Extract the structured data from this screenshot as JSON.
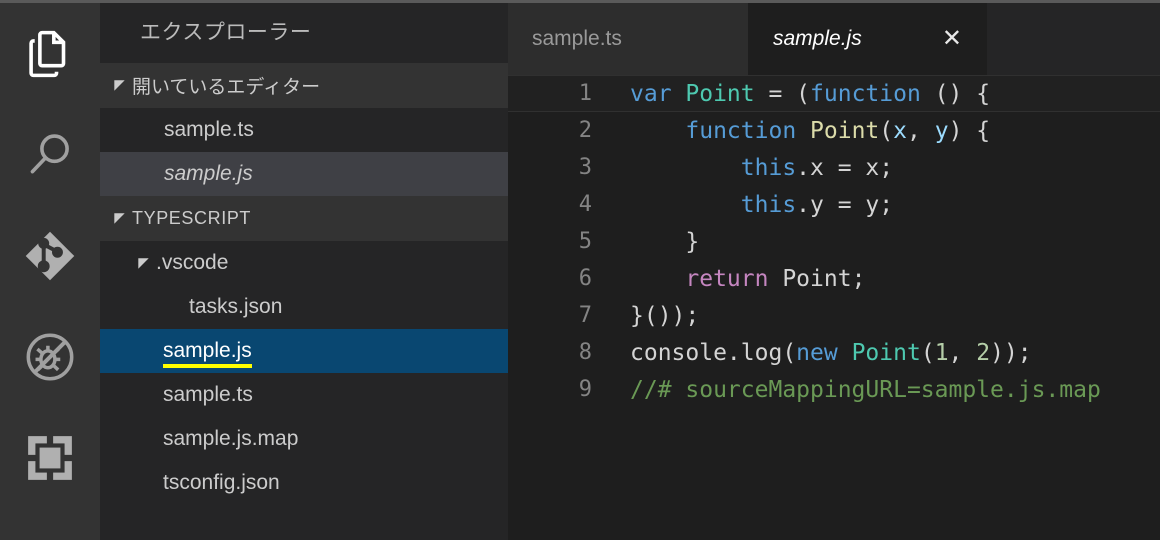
{
  "theme": {
    "activity_bar_bg": "#333333",
    "sidebar_bg": "#252526",
    "editor_bg": "#1e1e1e",
    "tab_active_bg": "#1e1e1e",
    "tab_inactive_bg": "#2d2d2d",
    "selection_blue": "#094771",
    "hover_grey": "#3f4045",
    "annotation_yellow": "#ffff00",
    "line_number_fg": "#848484"
  },
  "activity_bar": {
    "items": [
      {
        "name": "explorer",
        "icon": "files-icon",
        "active": true
      },
      {
        "name": "search",
        "icon": "search-icon",
        "active": false
      },
      {
        "name": "source-control",
        "icon": "git-branch-icon",
        "active": false
      },
      {
        "name": "debug",
        "icon": "debug-icon",
        "active": false
      },
      {
        "name": "extensions",
        "icon": "extensions-icon",
        "active": false
      }
    ]
  },
  "sidebar": {
    "title": "エクスプローラー",
    "open_editors": {
      "header": "開いているエディター",
      "items": [
        {
          "label": "sample.ts",
          "italic": false,
          "state": "normal"
        },
        {
          "label": "sample.js",
          "italic": true,
          "state": "hovered"
        }
      ]
    },
    "project": {
      "header": "TYPESCRIPT",
      "items": [
        {
          "label": ".vscode",
          "type": "folder",
          "depth": 1,
          "expanded": true,
          "state": "normal"
        },
        {
          "label": "tasks.json",
          "type": "file",
          "depth": 2,
          "state": "normal"
        },
        {
          "label": "sample.js",
          "type": "file",
          "depth": 1,
          "state": "selected",
          "annotated": true
        },
        {
          "label": "sample.ts",
          "type": "file",
          "depth": 1,
          "state": "normal"
        },
        {
          "label": "sample.js.map",
          "type": "file",
          "depth": 1,
          "state": "normal"
        },
        {
          "label": "tsconfig.json",
          "type": "file",
          "depth": 1,
          "state": "normal"
        }
      ]
    }
  },
  "editor": {
    "tabs": [
      {
        "label": "sample.ts",
        "active": false,
        "italic": false,
        "closable": false
      },
      {
        "label": "sample.js",
        "active": true,
        "italic": true,
        "closable": true,
        "close_glyph": "✕"
      }
    ],
    "language": "javascript",
    "active_line": 1,
    "line_numbers": [
      "1",
      "2",
      "3",
      "4",
      "5",
      "6",
      "7",
      "8",
      "9"
    ],
    "lines": [
      {
        "n": "1",
        "tokens": [
          {
            "t": "var ",
            "c": "kw"
          },
          {
            "t": "Point",
            "c": "type"
          },
          {
            "t": " = (",
            "c": "plain"
          },
          {
            "t": "function",
            "c": "kw"
          },
          {
            "t": " () {",
            "c": "plain"
          }
        ]
      },
      {
        "n": "2",
        "tokens": [
          {
            "t": "    ",
            "c": "plain"
          },
          {
            "t": "function",
            "c": "kw"
          },
          {
            "t": " ",
            "c": "plain"
          },
          {
            "t": "Point",
            "c": "fn"
          },
          {
            "t": "(",
            "c": "plain"
          },
          {
            "t": "x",
            "c": "param"
          },
          {
            "t": ", ",
            "c": "plain"
          },
          {
            "t": "y",
            "c": "param"
          },
          {
            "t": ") {",
            "c": "plain"
          }
        ]
      },
      {
        "n": "3",
        "tokens": [
          {
            "t": "        ",
            "c": "plain"
          },
          {
            "t": "this",
            "c": "kw"
          },
          {
            "t": ".x = x;",
            "c": "plain"
          }
        ]
      },
      {
        "n": "4",
        "tokens": [
          {
            "t": "        ",
            "c": "plain"
          },
          {
            "t": "this",
            "c": "kw"
          },
          {
            "t": ".y = y;",
            "c": "plain"
          }
        ]
      },
      {
        "n": "5",
        "tokens": [
          {
            "t": "    }",
            "c": "plain"
          }
        ]
      },
      {
        "n": "6",
        "tokens": [
          {
            "t": "    ",
            "c": "plain"
          },
          {
            "t": "return",
            "c": "ctrl"
          },
          {
            "t": " Point;",
            "c": "plain"
          }
        ]
      },
      {
        "n": "7",
        "tokens": [
          {
            "t": "}());",
            "c": "plain"
          }
        ]
      },
      {
        "n": "8",
        "tokens": [
          {
            "t": "console.log(",
            "c": "plain"
          },
          {
            "t": "new",
            "c": "kw"
          },
          {
            "t": " ",
            "c": "plain"
          },
          {
            "t": "Point",
            "c": "type"
          },
          {
            "t": "(",
            "c": "plain"
          },
          {
            "t": "1",
            "c": "num"
          },
          {
            "t": ", ",
            "c": "plain"
          },
          {
            "t": "2",
            "c": "num"
          },
          {
            "t": "));",
            "c": "plain"
          }
        ]
      },
      {
        "n": "9",
        "tokens": [
          {
            "t": "//# sourceMappingURL=sample.js.map",
            "c": "cmt"
          }
        ]
      }
    ]
  }
}
